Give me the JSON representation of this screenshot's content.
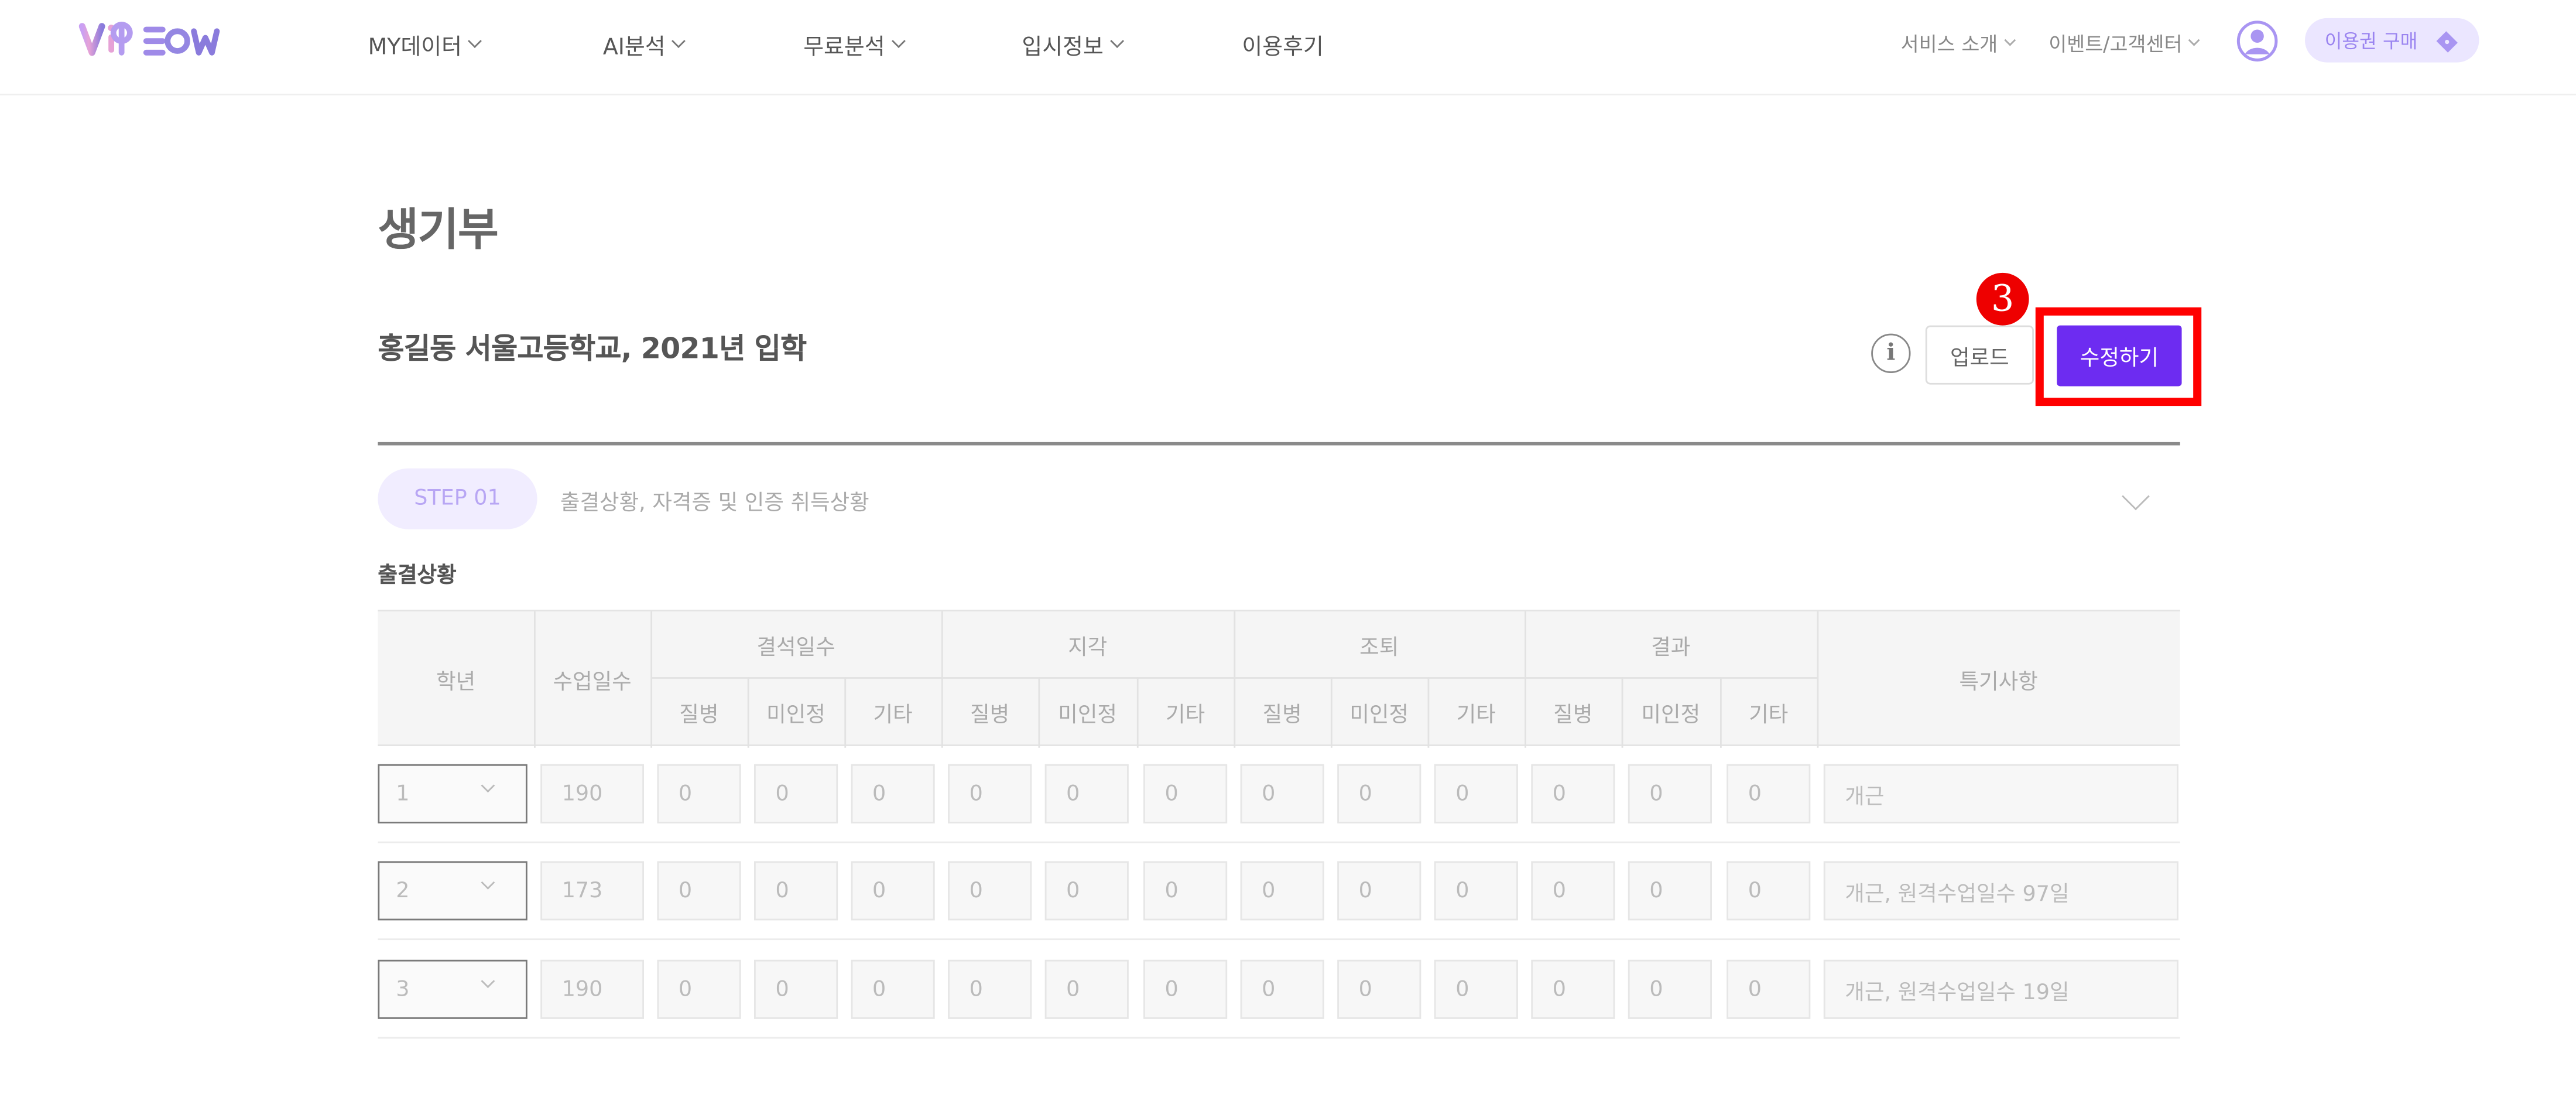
{
  "header": {
    "logo": "VIbEOM",
    "nav": [
      {
        "label": "MY데이터"
      },
      {
        "label": "AI분석"
      },
      {
        "label": "무료분석"
      },
      {
        "label": "입시정보"
      },
      {
        "label": "이용후기"
      }
    ],
    "right": {
      "service": "서비스 소개",
      "events": "이벤트/고객센터",
      "ticket": "이용권 구매"
    }
  },
  "page": {
    "title": "생기부",
    "school": "홍길동 서울고등학교, 2021년 입학",
    "info_icon": "i",
    "upload_label": "업로드",
    "edit_label": "수정하기",
    "step_marker": "3"
  },
  "step": {
    "badge": "STEP 01",
    "desc": "출결상황, 자격증 및 인증 취득상황"
  },
  "attendance": {
    "section_label": "출결상황",
    "headers": {
      "grade": "학년",
      "days": "수업일수",
      "groups": [
        "결석일수",
        "지각",
        "조퇴",
        "결과"
      ],
      "sub": [
        "질병",
        "미인정",
        "기타"
      ],
      "notes": "특기사항"
    },
    "rows": [
      {
        "grade": "1",
        "days": "190",
        "values": [
          "0",
          "0",
          "0",
          "0",
          "0",
          "0",
          "0",
          "0",
          "0",
          "0",
          "0",
          "0"
        ],
        "note": "개근"
      },
      {
        "grade": "2",
        "days": "173",
        "values": [
          "0",
          "0",
          "0",
          "0",
          "0",
          "0",
          "0",
          "0",
          "0",
          "0",
          "0",
          "0"
        ],
        "note": "개근, 원격수업일수 97일"
      },
      {
        "grade": "3",
        "days": "190",
        "values": [
          "0",
          "0",
          "0",
          "0",
          "0",
          "0",
          "0",
          "0",
          "0",
          "0",
          "0",
          "0"
        ],
        "note": "개근, 원격수업일수 19일"
      }
    ]
  },
  "colors": {
    "accent": "#6d2cf1",
    "highlight": "#ff0000",
    "pill_bg": "#f1edff"
  }
}
